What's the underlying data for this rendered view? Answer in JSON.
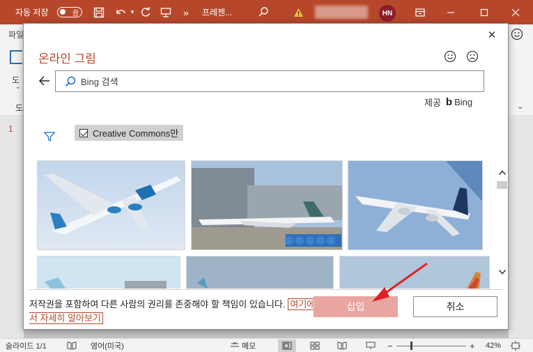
{
  "titlebar": {
    "autosave_label": "자동 저장",
    "autosave_state": "끔",
    "document_name": "프레젠...",
    "user_initials": "HN",
    "overflow_glyph": "»"
  },
  "background": {
    "file_tab": "파일",
    "draw_label": "도",
    "ribbon_group_label": "도",
    "slide_number": "1"
  },
  "dialog": {
    "title": "온라인 그림",
    "search_placeholder": "Bing 검색",
    "provider_prefix": "제공",
    "provider_name": "Bing",
    "cc_filter_label": "Creative Commons만",
    "cc_filter_checked": true,
    "notice_text": "저작권을 포함하여 다른 사람의 권리를 존중해야 할 책임이 있습니다.",
    "learn_more_link": "여기에서 자세히 알아보기",
    "insert_label": "삽입",
    "cancel_label": "취소"
  },
  "statusbar": {
    "slide_info": "슬라이드 1/1",
    "language": "영어(미국)",
    "notes_label": "메모",
    "zoom": "42%"
  },
  "colors": {
    "accent": "#b7472a",
    "insert_button": "#e9a6a0",
    "annotation_arrow": "#e02020"
  }
}
